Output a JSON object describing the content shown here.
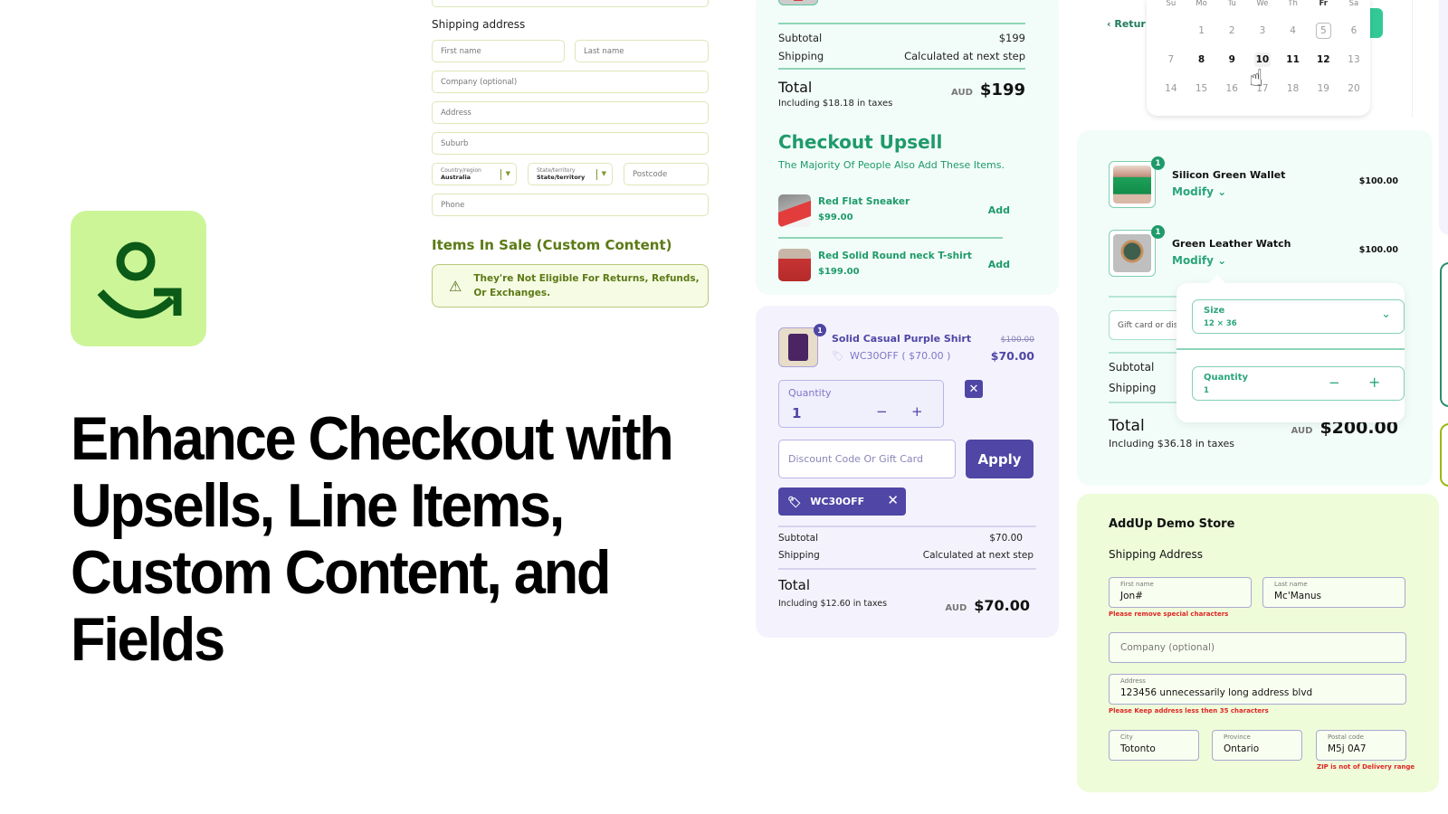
{
  "hero": {
    "title": "Enhance Checkout with Upsells, Line Items, Custom Content, and Fields",
    "logo_icon": "addup-logo-icon",
    "brand_color": "#ccf598",
    "logo_color": "#0b5a17"
  },
  "form1": {
    "heading": "Shipping address",
    "first_name_ph": "First name",
    "last_name_ph": "Last name",
    "company_ph": "Company (optional)",
    "address_ph": "Address",
    "suburb_ph": "Suburb",
    "country_label": "Country/region",
    "country_value": "Australia",
    "state_label": "State/territory",
    "state_value": "State/territory",
    "postcode_ph": "Postcode",
    "phone_ph": "Phone",
    "sale_title": "Items In Sale (Custom Content)",
    "sale_message": "They're Not Eligible For Returns, Refunds, Or Exchanges.",
    "warn_icon": "warning-triangle-icon"
  },
  "upsell": {
    "subtotal_label": "Subtotal",
    "subtotal_value": "$199",
    "shipping_label": "Shipping",
    "shipping_value": "Calculated at next step",
    "total_label": "Total",
    "taxes": "Including $18.18 in taxes",
    "currency": "AUD",
    "total_value": "$199",
    "heading": "Checkout Upsell",
    "subheading": "The Majority Of People Also Add These Items.",
    "items": [
      {
        "name": "Red Flat Sneaker",
        "price": "$99.00",
        "action": "Add"
      },
      {
        "name": "Red Solid Round neck T-shirt",
        "price": "$199.00",
        "action": "Add"
      }
    ],
    "accent": "#1f9a6b"
  },
  "purple": {
    "badge": "1",
    "product_name": "Solid Casual Purple Shirt",
    "discount_line": "WC30OFF ( $70.00 )",
    "was_price": "$100.00",
    "now_price": "$70.00",
    "quantity_label": "Quantity",
    "quantity_value": "1",
    "minus": "−",
    "plus": "+",
    "remove": "✕",
    "discount_ph": "Discount Code Or Gift Card",
    "apply_label": "Apply",
    "chip_code": "WC30OFF",
    "chip_remove": "✕",
    "subtotal_label": "Subtotal",
    "subtotal_value": "$70.00",
    "shipping_label": "Shipping",
    "shipping_value": "Calculated at next step",
    "total_label": "Total",
    "taxes": "Including $12.60 in taxes",
    "currency": "AUD",
    "total_value": "$70.00",
    "accent": "#4f46a5"
  },
  "calendar": {
    "return_label": "Retur",
    "weekdays": [
      "Su",
      "Mo",
      "Tu",
      "We",
      "Th",
      "Fr",
      "Sa"
    ],
    "weeks": [
      [
        "",
        "1",
        "2",
        "3",
        "4",
        "5",
        "6"
      ],
      [
        "7",
        "8",
        "9",
        "10",
        "11",
        "12",
        "13"
      ],
      [
        "14",
        "15",
        "16",
        "17",
        "18",
        "19",
        "20"
      ]
    ],
    "today": "5",
    "hovered": "10",
    "available": [
      "8",
      "9",
      "10",
      "11",
      "12"
    ]
  },
  "lines": {
    "items": [
      {
        "badge": "1",
        "name": "Silicon Green Wallet",
        "modify": "Modify",
        "price": "$100.00"
      },
      {
        "badge": "1",
        "name": "Green Leather Watch",
        "modify": "Modify",
        "price": "$100.00"
      }
    ],
    "gift_ph": "Gift card or discount code",
    "subtotal_label": "Subtotal",
    "shipping_label": "Shipping",
    "total_label": "Total",
    "taxes": "Including $36.18 in taxes",
    "currency": "AUD",
    "total_value": "$200.00",
    "popover": {
      "size_label": "Size",
      "size_value": "12 × 36",
      "quantity_label": "Quantity",
      "quantity_value": "1",
      "minus": "−",
      "plus": "+"
    }
  },
  "address": {
    "store": "AddUp Demo Store",
    "heading": "Shipping Address",
    "first_name_label": "First name",
    "first_name_value": "Jon#",
    "last_name_label": "Last name",
    "last_name_value": "Mc'Manus",
    "name_error": "Please remove special characters",
    "company_ph": "Company (optional)",
    "address_label": "Address",
    "address_value": "123456 unnecessarily long address blvd",
    "address_error": "Please Keep address less then 35 characters",
    "city_label": "City",
    "city_value": "Totonto",
    "province_label": "Province",
    "province_value": "Ontario",
    "postal_label": "Postal code",
    "postal_value": "M5j 0A7",
    "postal_error": "ZIP is not of Delivery range"
  }
}
